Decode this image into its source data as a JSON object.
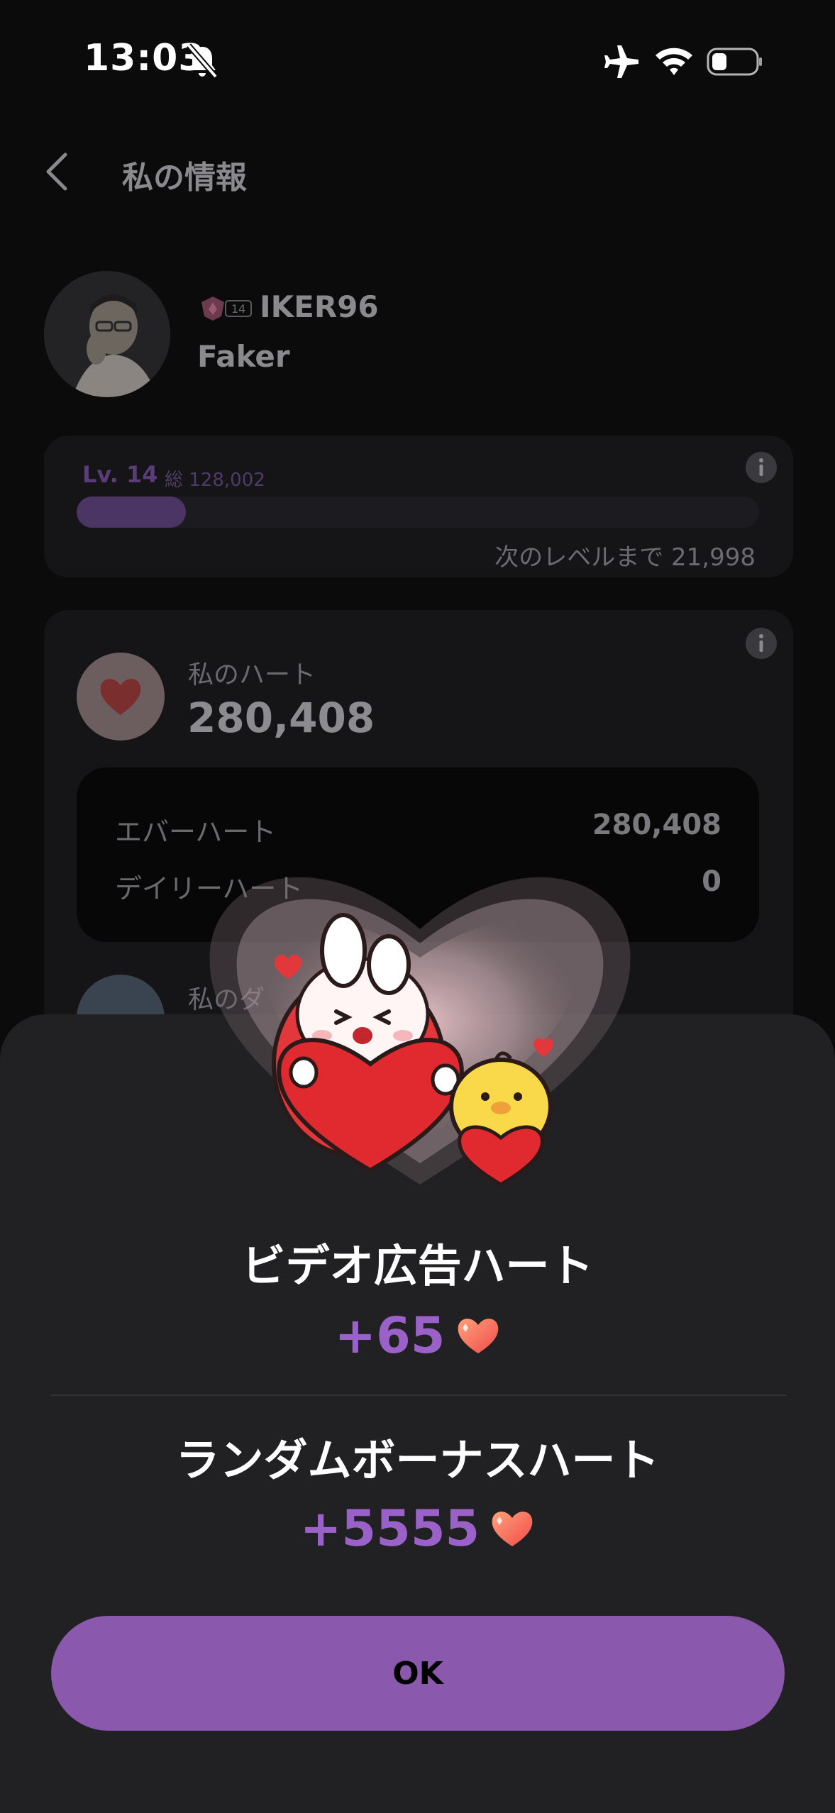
{
  "status_bar": {
    "time": "13:03",
    "icons": [
      "bell-slash-icon",
      "airplane-icon",
      "wifi-icon",
      "battery-icon"
    ]
  },
  "header": {
    "title": "私の情報",
    "back_icon": "chevron-left-icon"
  },
  "profile": {
    "badge_level": "14",
    "user_id": "IKER96",
    "nickname": "Faker"
  },
  "level": {
    "label": "Lv. 14",
    "total": "総 128,002",
    "progress": 0.16,
    "next_text": "次のレベルまで 21,998"
  },
  "hearts": {
    "label": "私のハート",
    "value": "280,408",
    "ever_label": "エバーハート",
    "ever_value": "280,408",
    "daily_label": "デイリーハート",
    "daily_value": "0",
    "next_label": "私のダ"
  },
  "sheet": {
    "video_title": "ビデオ広告ハート",
    "video_amount": "+65",
    "bonus_title": "ランダムボーナスハート",
    "bonus_amount": "+5555",
    "ok_label": "OK"
  },
  "colors": {
    "accent": "#8a58ac",
    "amount": "#9a62c9",
    "sheet_bg": "#212123",
    "heart": "#e8403c"
  }
}
